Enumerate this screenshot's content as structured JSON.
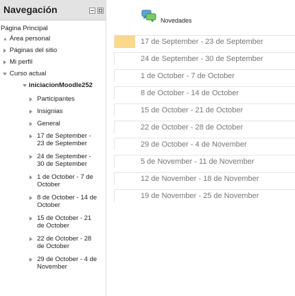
{
  "navigation": {
    "title": "Navegación",
    "home": "Página Principal",
    "items": [
      {
        "label": "Área personal"
      },
      {
        "label": "Páginas del sitio"
      },
      {
        "label": "Mi perfil"
      },
      {
        "label": "Curso actual"
      }
    ],
    "course": {
      "name": "iniciacionMoodle252",
      "children": [
        {
          "label": "Participantes"
        },
        {
          "label": "Insignias"
        },
        {
          "label": "General"
        },
        {
          "line1": "17 de September -",
          "line2": "23 de September"
        },
        {
          "line1": "24 de September -",
          "line2": "30 de September"
        },
        {
          "line1": "1 de October - 7 de",
          "line2": "October"
        },
        {
          "line1": "8 de October - 14 de",
          "line2": "October"
        },
        {
          "line1": "15 de October - 21",
          "line2": "de October"
        },
        {
          "line1": "22 de October - 28",
          "line2": "de October"
        },
        {
          "line1": "29 de October - 4 de",
          "line2": "November"
        }
      ]
    }
  },
  "main": {
    "news_label": "Novedades",
    "weeks": [
      {
        "label": "17 de September - 23 de September",
        "current": true
      },
      {
        "label": "24 de September - 30 de September",
        "current": false
      },
      {
        "label": "1 de October - 7 de October",
        "current": false
      },
      {
        "label": "8 de October - 14 de October",
        "current": false
      },
      {
        "label": "15 de October - 21 de October",
        "current": false
      },
      {
        "label": "22 de October - 28 de October",
        "current": false
      },
      {
        "label": "29 de October - 4 de November",
        "current": false
      },
      {
        "label": "5 de November - 11 de November",
        "current": false
      },
      {
        "label": "12 de November - 18 de November",
        "current": false
      },
      {
        "label": "19 de November - 25 de November",
        "current": false
      }
    ]
  },
  "colors": {
    "current_week": "#fbd88c",
    "header_bg": "#e3e3e3",
    "week_text": "#777777"
  },
  "icons": {
    "news": "forum-speech-bubbles-icon",
    "header_controls": [
      "collapse-block-icon",
      "dock-block-icon"
    ]
  }
}
